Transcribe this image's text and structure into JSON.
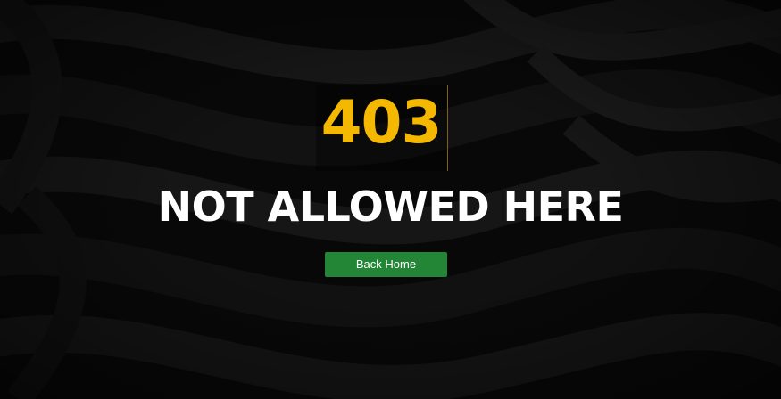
{
  "error": {
    "code": "403",
    "message": "NOT ALLOWED HERE"
  },
  "actions": {
    "back_home_label": "Back Home"
  },
  "colors": {
    "background": "#0a0a0a",
    "code_accent": "#f5b800",
    "headline": "#ffffff",
    "button_bg": "#238636",
    "divider": "#7a6413"
  }
}
